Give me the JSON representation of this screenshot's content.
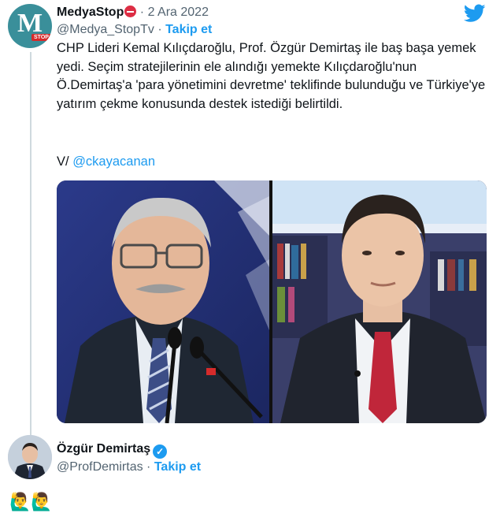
{
  "tweet": {
    "author_name": "MedyaStop",
    "avatar_letter": "M",
    "avatar_badge": "STOP",
    "date": "2 Ara 2022",
    "handle": "@Medya_StopTv",
    "follow_label": "Takip et",
    "separator": "·",
    "text_line1": "CHP Lideri Kemal Kılıçdaroğlu, Prof. Özgür Demirtaş ile baş başa yemek yedi. Seçim stratejilerinin ele alındığı yemekte Kılıçdaroğlu'nun Ö.Demirtaş'a 'para yönetimini devretme' teklifinde bulunduğu ve Türkiye'ye yatırım çekme konusunda destek istediği belirtildi.",
    "via_prefix": "V/",
    "via_mention": "@ckayacanan"
  },
  "reply": {
    "author_name": "Özgür Demirtaş",
    "handle": "@ProfDemirtas",
    "separator": "·",
    "follow_label": "Takip et",
    "emojis": "🙋‍♂️🙋‍♂️"
  },
  "colors": {
    "accent": "#1d9bf0",
    "muted": "#536471",
    "thread_line": "#cfd9de"
  },
  "icons": [
    "twitter-bird-icon",
    "no-entry-icon",
    "verified-badge-icon"
  ]
}
